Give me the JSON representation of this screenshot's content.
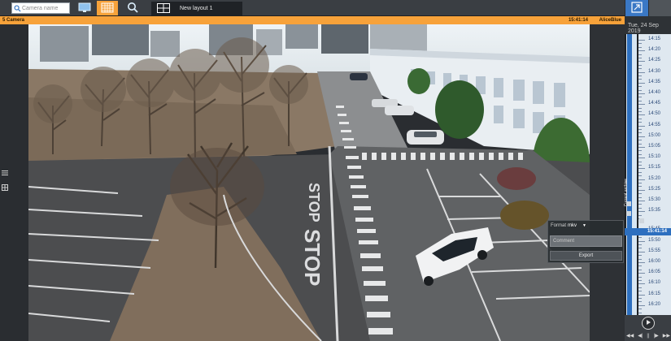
{
  "toolbar": {
    "search_placeholder": "Camera name",
    "layout_tab_label": "New layout 1"
  },
  "camera": {
    "name": "5 Camera",
    "time": "15:41:14",
    "user": "AliceBlue"
  },
  "export_panel": {
    "format_label": "Format",
    "format_value": "mkv",
    "comment_placeholder": "Comment",
    "export_label": "Export"
  },
  "timeline": {
    "date": "Tue, 24 Sep 2019",
    "vertical_label": "Current archive",
    "current_time": "15:41:14",
    "labels": [
      "14:15",
      "14:20",
      "14:25",
      "14:30",
      "14:35",
      "14:40",
      "14:45",
      "14:50",
      "14:55",
      "15:00",
      "15:05",
      "15:10",
      "15:15",
      "15:20",
      "15:25",
      "15:30",
      "15:35",
      "15:45",
      "15:50",
      "15:55",
      "16:00",
      "16:05",
      "16:10",
      "16:15",
      "16:20"
    ]
  },
  "colors": {
    "accent_orange": "#f7a23a",
    "timeline_blue": "#2d6fbf",
    "toolbar_bg": "#3a3e43"
  },
  "icons": [
    "search-icon",
    "monitor-icon",
    "layout-icon",
    "magnifier-icon",
    "grid-icon",
    "expand-icon",
    "menu-icon",
    "grid-small-icon",
    "info-icon",
    "play-icon"
  ]
}
